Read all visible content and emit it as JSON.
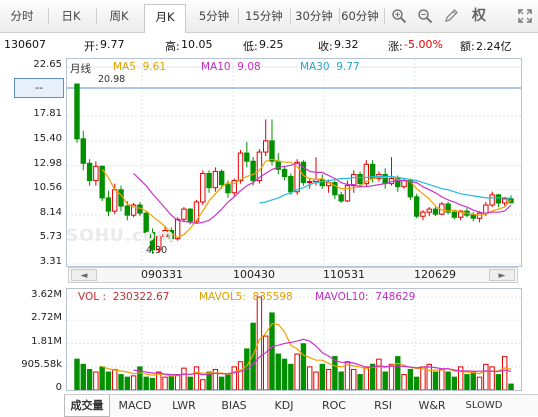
{
  "toolbar": {
    "tabs": [
      {
        "label": "分时",
        "name": "tab-fenshi"
      },
      {
        "label": "日K",
        "name": "tab-daily-k"
      },
      {
        "label": "周K",
        "name": "tab-weekly-k"
      },
      {
        "label": "月K",
        "name": "tab-monthly-k"
      },
      {
        "label": "5分钟",
        "name": "tab-5min"
      },
      {
        "label": "15分钟",
        "name": "tab-15min"
      },
      {
        "label": "30分钟",
        "name": "tab-30min"
      },
      {
        "label": "60分钟",
        "name": "tab-60min"
      }
    ],
    "active_tab": "月K",
    "tools": [
      "zoom-in-icon",
      "zoom-out-icon",
      "pencil-icon"
    ],
    "quan_label": "权",
    "fullscreen_icon": "expand-icon"
  },
  "quote": {
    "code": "130607",
    "open_label": "开:",
    "open": "9.77",
    "high_label": "高:",
    "high": "10.05",
    "low_label": "低:",
    "low": "9.25",
    "close_label": "收:",
    "close": "9.32",
    "change_label": "涨:",
    "change": "-5.00%",
    "amount_label": "额:",
    "amount": "2.24亿"
  },
  "price_panel": {
    "period_label": "月线",
    "ma5_label": "MA5",
    "ma5": "9.61",
    "ma10_label": "MA10",
    "ma10": "9.08",
    "ma30_label": "MA30",
    "ma30": "9.77",
    "y_ticks": [
      "22.65",
      "17.81",
      "15.40",
      "12.98",
      "10.56",
      "8.14",
      "5.73",
      "3.31"
    ],
    "crosshair_label": "--",
    "high_marker": "20.98",
    "low_marker": "4.30",
    "watermark": "SOHU.com"
  },
  "scroll": {
    "x_labels": [
      "090331",
      "100430",
      "110531",
      "120629"
    ],
    "left_arrow": "◄",
    "right_arrow": "►"
  },
  "volume_panel": {
    "vol_label": "VOL :",
    "vol": "230322.67",
    "mavol5_label": "MAVOL5:",
    "mavol5": "835598",
    "mavol10_label": "MAVOL10:",
    "mavol10": "748629",
    "y_ticks": [
      "3.62M",
      "2.72M",
      "1.81M",
      "905.58k",
      "0"
    ]
  },
  "indicator_tabs": [
    "成交量",
    "MACD",
    "LWR",
    "BIAS",
    "KDJ",
    "ROC",
    "RSI",
    "W&R",
    "SLOWD"
  ],
  "colors": {
    "up": "#e00000",
    "down": "#009000",
    "ma5": "#f0a000",
    "ma10": "#cc33cc",
    "ma30": "#22bbdd",
    "grid": "#dfe6ef"
  },
  "chart_data": {
    "type": "candlestick",
    "period": "monthly",
    "ylim": [
      3.31,
      22.65
    ],
    "x_tick_labels": [
      "090331",
      "100430",
      "110531",
      "120629"
    ],
    "candles": [
      [
        20.98,
        20.98,
        15.2,
        15.6
      ],
      [
        15.6,
        16.4,
        12.5,
        13.2
      ],
      [
        13.2,
        13.6,
        11.0,
        11.5
      ],
      [
        11.5,
        13.4,
        11.0,
        12.9
      ],
      [
        12.9,
        13.0,
        9.5,
        9.8
      ],
      [
        9.8,
        10.5,
        8.0,
        8.5
      ],
      [
        8.5,
        11.2,
        8.2,
        10.6
      ],
      [
        10.6,
        11.0,
        8.5,
        9.0
      ],
      [
        9.0,
        9.5,
        7.6,
        8.1
      ],
      [
        8.1,
        9.3,
        7.9,
        9.1
      ],
      [
        9.1,
        9.4,
        8.0,
        8.3
      ],
      [
        8.3,
        8.5,
        6.0,
        6.4
      ],
      [
        6.4,
        6.8,
        4.3,
        4.7
      ],
      [
        4.7,
        6.2,
        4.5,
        6.0
      ],
      [
        6.0,
        7.0,
        5.6,
        6.6
      ],
      [
        6.6,
        6.9,
        5.5,
        5.8
      ],
      [
        5.8,
        7.9,
        5.6,
        7.7
      ],
      [
        7.7,
        8.9,
        7.4,
        8.7
      ],
      [
        8.7,
        8.8,
        7.2,
        7.5
      ],
      [
        7.5,
        9.6,
        7.3,
        9.4
      ],
      [
        9.4,
        12.5,
        9.1,
        12.2
      ],
      [
        12.2,
        12.5,
        10.3,
        10.8
      ],
      [
        10.8,
        12.8,
        10.4,
        12.4
      ],
      [
        12.4,
        12.6,
        10.7,
        11.1
      ],
      [
        11.1,
        11.5,
        9.8,
        10.3
      ],
      [
        10.3,
        11.7,
        10.0,
        11.5
      ],
      [
        11.5,
        14.5,
        11.2,
        14.2
      ],
      [
        14.2,
        15.3,
        12.8,
        13.4
      ],
      [
        13.4,
        13.8,
        11.0,
        11.5
      ],
      [
        11.5,
        14.6,
        11.2,
        14.3
      ],
      [
        14.3,
        17.5,
        13.9,
        15.4
      ],
      [
        15.4,
        17.5,
        13.0,
        13.4
      ],
      [
        13.4,
        14.2,
        12.1,
        12.6
      ],
      [
        12.6,
        12.9,
        11.5,
        11.9
      ],
      [
        11.9,
        12.2,
        10.1,
        10.4
      ],
      [
        10.4,
        13.6,
        10.1,
        13.3
      ],
      [
        13.3,
        13.5,
        11.0,
        11.3
      ],
      [
        11.3,
        11.7,
        10.7,
        11.4
      ],
      [
        11.4,
        13.8,
        11.0,
        11.6
      ],
      [
        11.6,
        12.1,
        10.7,
        11.0
      ],
      [
        11.0,
        11.6,
        10.3,
        11.3
      ],
      [
        11.3,
        11.5,
        9.7,
        10.1
      ],
      [
        10.1,
        10.4,
        9.3,
        9.5
      ],
      [
        9.5,
        11.5,
        9.4,
        11.0
      ],
      [
        11.0,
        12.5,
        10.3,
        12.1
      ],
      [
        12.1,
        12.4,
        10.8,
        11.2
      ],
      [
        11.2,
        13.5,
        10.9,
        13.1
      ],
      [
        13.1,
        13.5,
        11.3,
        11.7
      ],
      [
        11.7,
        12.4,
        11.4,
        12.1
      ],
      [
        12.1,
        12.7,
        10.7,
        11.2
      ],
      [
        11.2,
        13.8,
        11.0,
        11.7
      ],
      [
        11.7,
        12.0,
        10.4,
        10.9
      ],
      [
        10.9,
        11.7,
        10.7,
        11.5
      ],
      [
        11.5,
        11.7,
        9.6,
        9.9
      ],
      [
        9.9,
        10.2,
        7.8,
        8.0
      ],
      [
        8.0,
        8.6,
        7.6,
        8.4
      ],
      [
        8.4,
        8.9,
        8.0,
        8.7
      ],
      [
        8.7,
        8.9,
        8.0,
        8.2
      ],
      [
        8.2,
        9.4,
        8.1,
        9.2
      ],
      [
        9.2,
        9.4,
        8.2,
        8.4
      ],
      [
        8.4,
        8.6,
        7.7,
        7.9
      ],
      [
        7.9,
        8.6,
        7.6,
        8.5
      ],
      [
        8.5,
        8.8,
        7.9,
        8.1
      ],
      [
        8.1,
        8.4,
        7.5,
        7.8
      ],
      [
        7.8,
        8.5,
        7.4,
        8.3
      ],
      [
        8.3,
        9.4,
        8.0,
        9.1
      ],
      [
        9.1,
        10.4,
        8.9,
        10.1
      ],
      [
        10.1,
        10.2,
        8.9,
        9.3
      ],
      [
        9.3,
        9.9,
        9.0,
        9.7
      ],
      [
        9.7,
        10.05,
        9.25,
        9.32
      ]
    ],
    "volume_ylim": [
      0,
      3620000
    ],
    "volume": [
      1200000,
      1000000,
      800000,
      700000,
      900000,
      700000,
      800000,
      600000,
      500000,
      550000,
      900000,
      500000,
      450000,
      700000,
      500000,
      550000,
      600000,
      850000,
      500000,
      900000,
      400000,
      700000,
      800000,
      500000,
      600000,
      900000,
      1100000,
      1600000,
      2600000,
      3620000,
      2100000,
      3000000,
      1400000,
      1200000,
      1000000,
      1400000,
      1800000,
      900000,
      700000,
      1000000,
      800000,
      1300000,
      700000,
      1100000,
      800000,
      600000,
      900000,
      1000000,
      1200000,
      700000,
      1000000,
      1300000,
      600000,
      800000,
      500000,
      900000,
      1000000,
      700000,
      800000,
      700000,
      500000,
      900000,
      600000,
      700000,
      500000,
      1000000,
      900000,
      600000,
      1300000,
      230322.67
    ],
    "series": [
      {
        "name": "MA5",
        "color": "#f0a000",
        "values": [
          null,
          null,
          null,
          null,
          12.6,
          11.8,
          10.6,
          10.1,
          9.2,
          8.9,
          8.8,
          8.5,
          8.0,
          7.5,
          7.0,
          6.3,
          5.9,
          6.2,
          6.8,
          7.6,
          8.5,
          9.5,
          10.2,
          10.9,
          11.3,
          11.2,
          11.6,
          11.9,
          12.1,
          12.5,
          13.4,
          13.6,
          13.4,
          13.3,
          13.3,
          12.9,
          12.0,
          11.7,
          11.6,
          11.7,
          11.3,
          11.0,
          10.7,
          10.7,
          10.8,
          10.9,
          11.4,
          11.7,
          11.8,
          11.8,
          11.9,
          11.6,
          11.5,
          11.4,
          10.7,
          10.2,
          9.7,
          9.0,
          8.6,
          8.5,
          8.6,
          8.4,
          8.3,
          8.2,
          8.1,
          8.2,
          8.5,
          8.7,
          8.9,
          9.61
        ]
      },
      {
        "name": "MA10",
        "color": "#cc33cc",
        "values": [
          null,
          null,
          null,
          null,
          null,
          null,
          null,
          null,
          null,
          12.2,
          11.6,
          11.0,
          10.2,
          9.5,
          8.8,
          8.1,
          7.6,
          7.5,
          7.4,
          7.3,
          7.4,
          7.6,
          8.1,
          8.7,
          9.4,
          9.9,
          10.5,
          11.0,
          11.3,
          11.8,
          12.2,
          12.6,
          12.8,
          12.9,
          13.0,
          13.2,
          12.8,
          12.4,
          12.3,
          12.3,
          12.0,
          11.7,
          11.3,
          11.1,
          11.1,
          10.9,
          10.9,
          11.0,
          11.1,
          11.2,
          11.4,
          11.5,
          11.5,
          11.4,
          11.3,
          10.9,
          10.6,
          10.3,
          9.9,
          9.6,
          9.4,
          9.1,
          8.9,
          8.6,
          8.4,
          8.3,
          8.4,
          8.4,
          8.5,
          9.08
        ]
      },
      {
        "name": "MA30",
        "color": "#22bbdd",
        "values": [
          null,
          null,
          null,
          null,
          null,
          null,
          null,
          null,
          null,
          null,
          null,
          null,
          null,
          null,
          null,
          null,
          null,
          null,
          null,
          null,
          null,
          null,
          null,
          null,
          null,
          null,
          null,
          null,
          null,
          9.3,
          9.4,
          9.6,
          9.8,
          10.1,
          10.3,
          10.6,
          10.8,
          11.1,
          11.3,
          11.4,
          11.5,
          11.6,
          11.7,
          11.7,
          11.8,
          11.8,
          11.8,
          11.9,
          11.9,
          11.9,
          11.9,
          11.8,
          11.7,
          11.6,
          11.5,
          11.3,
          11.1,
          10.9,
          10.7,
          10.6,
          10.4,
          10.2,
          10.1,
          10.0,
          9.9,
          9.8,
          9.8,
          9.8,
          9.8,
          9.77
        ]
      }
    ],
    "volume_series": [
      {
        "name": "MAVOL5",
        "color": "#f0a000"
      },
      {
        "name": "MAVOL10",
        "color": "#cc33cc"
      }
    ]
  }
}
